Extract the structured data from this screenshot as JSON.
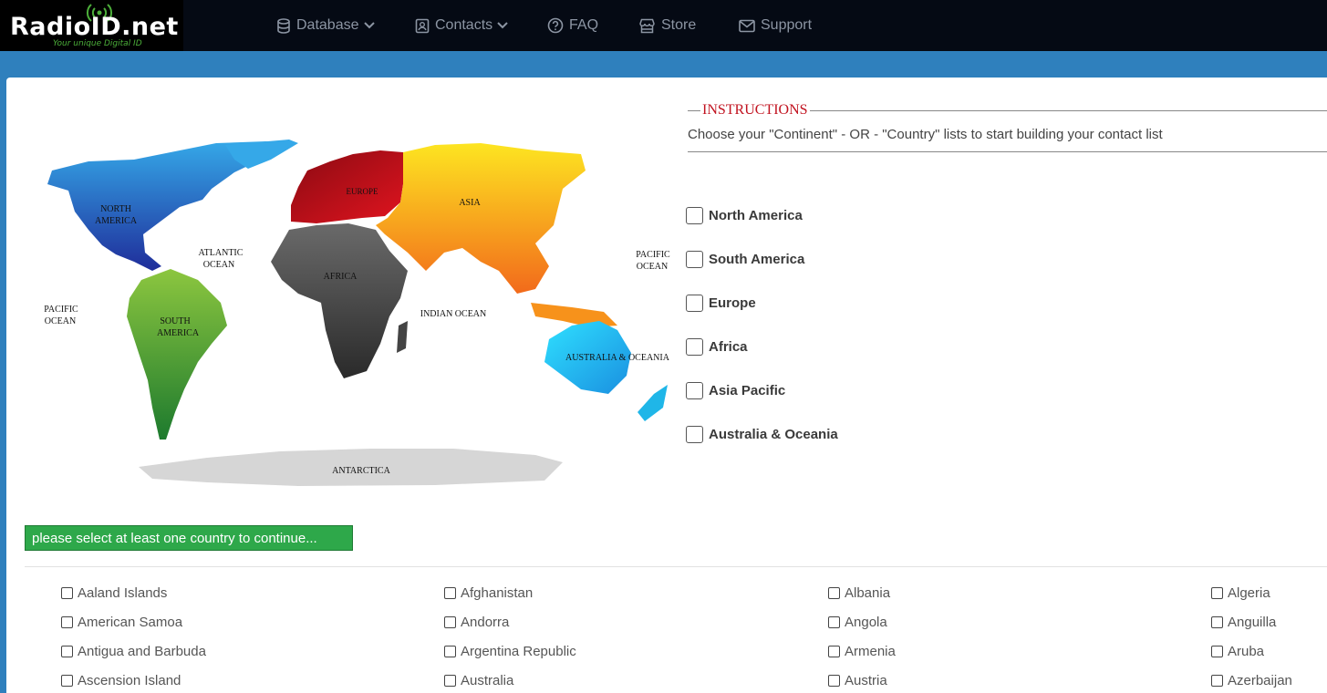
{
  "logo": {
    "text": "RadioID.net",
    "tagline": "Your unique Digital ID"
  },
  "nav": [
    {
      "label": "Database",
      "icon": "database-icon",
      "dropdown": true
    },
    {
      "label": "Contacts",
      "icon": "contact-card-icon",
      "dropdown": true
    },
    {
      "label": "FAQ",
      "icon": "question-circle-icon",
      "dropdown": false
    },
    {
      "label": "Store",
      "icon": "store-icon",
      "dropdown": false
    },
    {
      "label": "Support",
      "icon": "envelope-icon",
      "dropdown": false
    }
  ],
  "map": {
    "labels": {
      "north_america": [
        "NORTH",
        "AMERICA"
      ],
      "south_america": [
        "SOUTH",
        "AMERICA"
      ],
      "europe": "EUROPE",
      "asia": "ASIA",
      "africa": "AFRICA",
      "australia": "AUSTRALIA & OCEANIA",
      "antarctica": "ANTARCTICA",
      "atlantic": [
        "ATLANTIC",
        "OCEAN"
      ],
      "indian": "INDIAN OCEAN",
      "pacific_left": [
        "PACIFIC",
        "OCEAN"
      ],
      "pacific_right": [
        "PACIFIC",
        "OCEAN"
      ]
    },
    "colors": {
      "north_america": "#2f6fd6",
      "south_america": "#4fa83a",
      "europe": "#c4101c",
      "asia": "#f7a21b",
      "africa": "#4a4a4a",
      "australia": "#1fb6e8",
      "antarctica": "#d4d4d4"
    }
  },
  "instructions": {
    "title": "INSTRUCTIONS",
    "text": "Choose your \"Continent\" - OR - \"Country\" lists to start building your contact list"
  },
  "continents": [
    "North America",
    "South America",
    "Europe",
    "Africa",
    "Asia Pacific",
    "Australia & Oceania"
  ],
  "continue_button": "please select at least one country to continue...",
  "countries": [
    [
      "Aaland Islands",
      "Afghanistan",
      "Albania",
      "Algeria"
    ],
    [
      "American Samoa",
      "Andorra",
      "Angola",
      "Anguilla"
    ],
    [
      "Antigua and Barbuda",
      "Argentina Republic",
      "Armenia",
      "Aruba"
    ],
    [
      "Ascension Island",
      "Australia",
      "Austria",
      "Azerbaijan"
    ]
  ]
}
